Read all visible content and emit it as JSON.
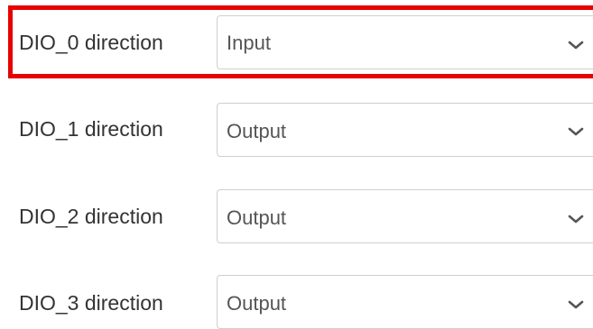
{
  "dio_rows": [
    {
      "label": "DIO_0 direction",
      "value": "Input",
      "icon": "chevron-down-icon"
    },
    {
      "label": "DIO_1 direction",
      "value": "Output",
      "icon": "chevron-down-icon"
    },
    {
      "label": "DIO_2 direction",
      "value": "Output",
      "icon": "chevron-down-icon"
    },
    {
      "label": "DIO_3 direction",
      "value": "Output",
      "icon": "chevron-down-icon"
    }
  ],
  "highlight_color": "#e60000"
}
